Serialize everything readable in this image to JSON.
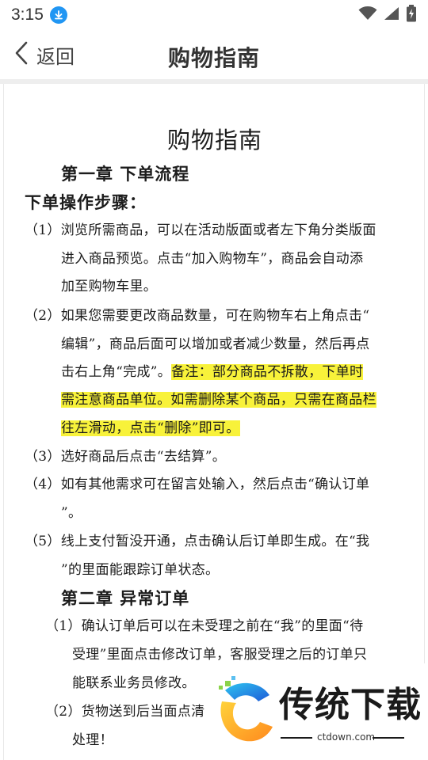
{
  "status_bar": {
    "time": "3:15",
    "icons": [
      "download-icon",
      "wifi-icon",
      "signal-icon",
      "battery-charging-icon"
    ]
  },
  "header": {
    "back_label": "返回",
    "title": "购物指南"
  },
  "document": {
    "title": "购物指南",
    "chapter1": "第一章 下单流程",
    "steps_heading": "下单操作步骤：",
    "step1": {
      "num": "（1）",
      "lines": [
        "浏览所需商品，可以在活动版面或者左下角分类版面",
        "进入商品预览。点击“加入购物车”，商品会自动添",
        "加至购物车里。"
      ]
    },
    "step2": {
      "num": "（2）",
      "line1": "如果您需要更改商品数量，可在购物车右上角点击“",
      "line2": "编辑”，商品后面可以增加或者减少数量，然后再点",
      "line3_plain": "击右上角“完成”。",
      "line3_highlight": "备注：部分商品不拆散，下单时",
      "line4_highlight": "需注意商品单位。如需删除某个商品，只需在商品栏",
      "line5_highlight": "往左滑动，点击“删除”即可。"
    },
    "step3": {
      "num": "（3）",
      "text": "选好商品后点击“去结算”。"
    },
    "step4": {
      "num": "（4）",
      "lines": [
        "如有其他需求可在留言处输入，然后点击“确认订单",
        "”。"
      ]
    },
    "step5": {
      "num": "（5）",
      "lines": [
        "线上支付暂没开通，点击确认后订单即生成。在“我",
        "”的里面能跟踪订单状态。"
      ]
    },
    "chapter2": "第二章  异常订单",
    "ex1": {
      "num": "（1）",
      "lines": [
        "确认订单后可以在未受理之前在“我”的里面“待",
        "受理”里面点击修改订单，客服受理之后的订单只",
        "能联系业务员修改。"
      ]
    },
    "ex2": {
      "num": "（2）",
      "lines": [
        "货物送到后当面点清",
        "处理！"
      ]
    }
  },
  "watermark": {
    "text": "传统下载",
    "sub": "ctdown.com"
  },
  "colors": {
    "highlight": "#f8f23a",
    "download_badge": "#2196f3"
  }
}
